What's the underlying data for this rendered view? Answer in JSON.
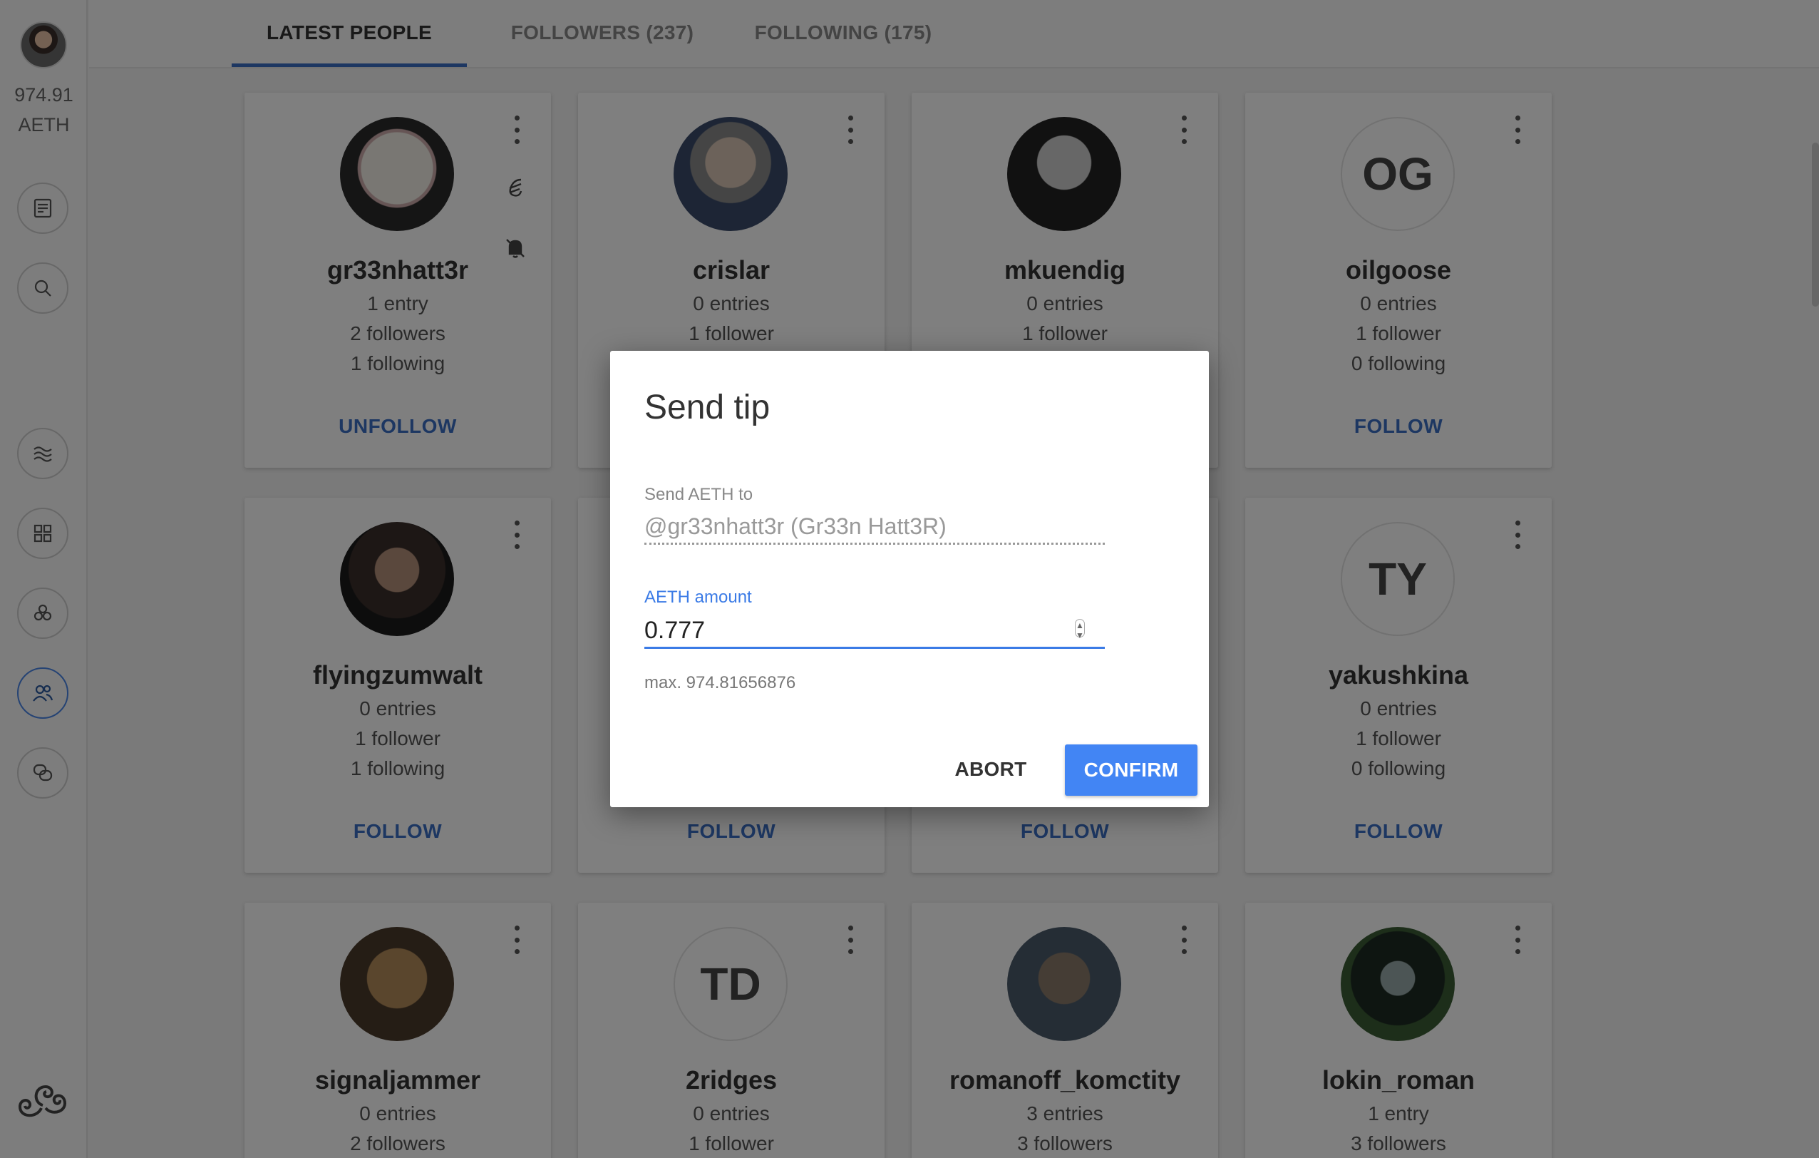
{
  "sidebar": {
    "balance_amount": "974.91",
    "balance_unit": "AETH",
    "buttons": [
      "entries-icon",
      "search-icon",
      "stream-icon",
      "dashboard-icon",
      "communities-icon",
      "people-icon",
      "chat-icon"
    ]
  },
  "tabs": [
    {
      "label": "LATEST PEOPLE",
      "active": true
    },
    {
      "label": "FOLLOWERS (237)",
      "active": false
    },
    {
      "label": "FOLLOWING (175)",
      "active": false
    }
  ],
  "cards": [
    {
      "username": "gr33nhatt3r",
      "entries": "1 entry",
      "followers": "2 followers",
      "following": "1 following",
      "action": "UNFOLLOW",
      "initials": ""
    },
    {
      "username": "crislar",
      "entries": "0 entries",
      "followers": "1 follower",
      "following": "",
      "action": "",
      "initials": ""
    },
    {
      "username": "mkuendig",
      "entries": "0 entries",
      "followers": "1 follower",
      "following": "",
      "action": "",
      "initials": ""
    },
    {
      "username": "oilgoose",
      "entries": "0 entries",
      "followers": "1 follower",
      "following": "0 following",
      "action": "FOLLOW",
      "initials": "OG"
    },
    {
      "username": "flyingzumwalt",
      "entries": "0 entries",
      "followers": "1 follower",
      "following": "1 following",
      "action": "FOLLOW",
      "initials": ""
    },
    {
      "username": "",
      "entries": "",
      "followers": "",
      "following": "",
      "action": "FOLLOW",
      "initials": ""
    },
    {
      "username": "",
      "entries": "",
      "followers": "",
      "following": "",
      "action": "FOLLOW",
      "initials": ""
    },
    {
      "username": "yakushkina",
      "entries": "0 entries",
      "followers": "1 follower",
      "following": "0 following",
      "action": "FOLLOW",
      "initials": "TY"
    },
    {
      "username": "signaljammer",
      "entries": "0 entries",
      "followers": "2 followers",
      "following": "",
      "action": "",
      "initials": ""
    },
    {
      "username": "2ridges",
      "entries": "0 entries",
      "followers": "1 follower",
      "following": "",
      "action": "",
      "initials": "TD"
    },
    {
      "username": "romanoff_komctity",
      "entries": "3 entries",
      "followers": "3 followers",
      "following": "",
      "action": "",
      "initials": ""
    },
    {
      "username": "lokin_roman",
      "entries": "1 entry",
      "followers": "3 followers",
      "following": "",
      "action": "",
      "initials": ""
    }
  ],
  "dialog": {
    "title": "Send tip",
    "to_label": "Send AETH to",
    "to_value": "@gr33nhatt3r (Gr33n Hatt3R)",
    "amount_label": "AETH amount",
    "amount_value": "0.777",
    "max_note": "max. 974.81656876",
    "abort_label": "ABORT",
    "confirm_label": "CONFIRM"
  },
  "colors": {
    "accent": "#3b6fc4",
    "confirm_button": "#4285f4",
    "focus": "#3b7be6"
  }
}
